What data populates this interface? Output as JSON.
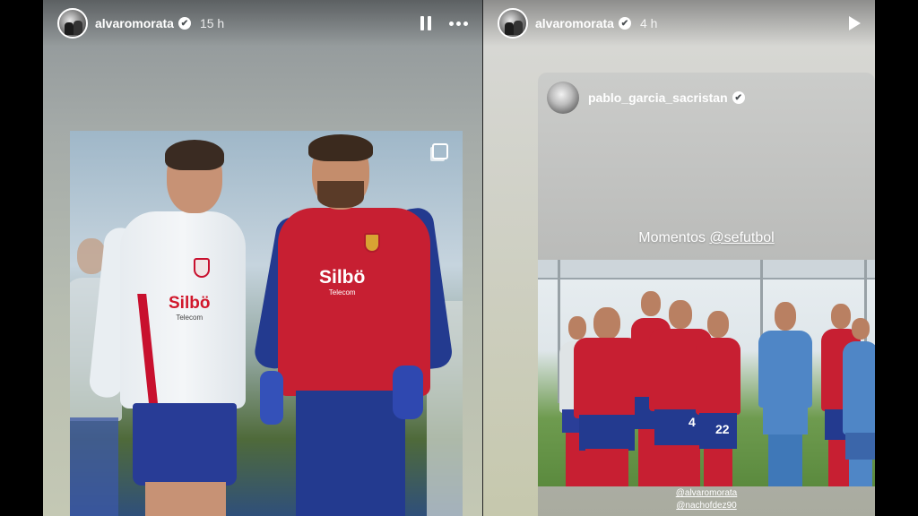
{
  "stories": [
    {
      "username": "alvaromorata",
      "verified": "✔",
      "time": "15 h",
      "photo": {
        "left_player_sponsor": "Silbö",
        "left_player_sponsor_sub": "Telecom",
        "right_player_sponsor": "Silbö",
        "right_player_sponsor_sub": "Telecom"
      },
      "controls": {
        "pause": "pause-icon",
        "more": "more-icon"
      }
    },
    {
      "username": "alvaromorata",
      "verified": "✔",
      "time": "4 h",
      "controls": {
        "play": "play-icon"
      },
      "shared_post": {
        "username": "pablo_garcia_sacristan",
        "verified": "✔",
        "caption_prefix": "Momentos ",
        "caption_mention": "@sefutbol",
        "jersey_numbers": [
          "4",
          "22"
        ],
        "tags": [
          "@alvaromorata",
          "@nachofdez90"
        ]
      }
    }
  ],
  "colors": {
    "spain_red": "#c71f32",
    "spain_blue": "#233a8f",
    "sponsor_red": "#d1172b"
  }
}
